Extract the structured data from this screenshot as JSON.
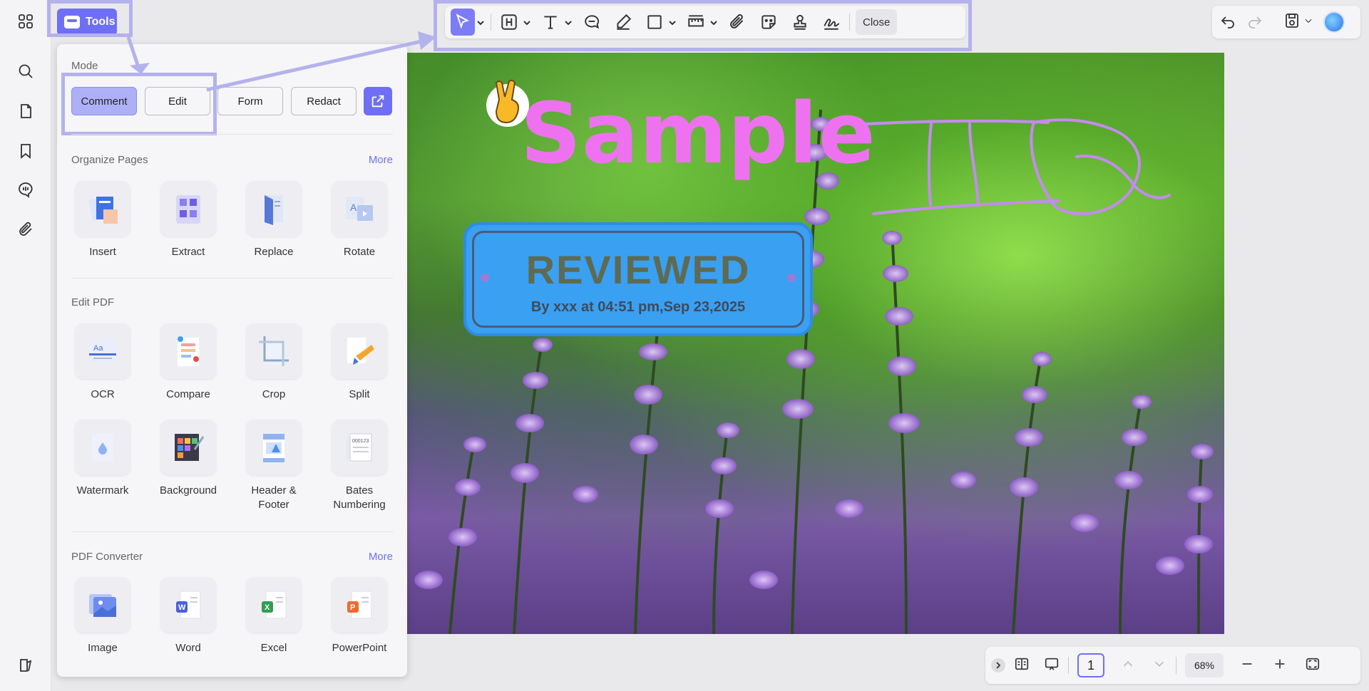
{
  "left_rail": {
    "items": [
      "apps-grid-icon",
      "search-icon",
      "pages-icon",
      "bookmark-icon",
      "comments-icon",
      "attachment-icon",
      "sidebar-settings-icon"
    ]
  },
  "tools_button": {
    "label": "Tools"
  },
  "toolbar": {
    "tools": [
      "select-pointer-icon",
      "highlight-text-icon",
      "text-box-icon",
      "comment-icon",
      "pencil-icon",
      "rectangle-shape-icon",
      "measure-icon",
      "attach-file-icon",
      "sticker-icon",
      "stamp-icon",
      "signature-icon"
    ],
    "close_label": "Close"
  },
  "panel": {
    "mode": {
      "label": "Mode",
      "buttons": [
        "Comment",
        "Edit",
        "Form",
        "Redact"
      ],
      "active": "Comment"
    },
    "organize": {
      "label": "Organize Pages",
      "more": "More",
      "tools": [
        "Insert",
        "Extract",
        "Replace",
        "Rotate"
      ]
    },
    "edit": {
      "label": "Edit PDF",
      "tools_row1": [
        "OCR",
        "Compare",
        "Crop",
        "Split"
      ],
      "tools_row2": [
        "Watermark",
        "Background",
        "Header & Footer",
        "Bates Numbering"
      ]
    },
    "converter": {
      "label": "PDF Converter",
      "more": "More",
      "tools": [
        "Image",
        "Word",
        "Excel",
        "PowerPoint"
      ]
    }
  },
  "document": {
    "sample_text": "Sample",
    "stamp_title": "REVIEWED",
    "stamp_sub": "By xxx at 04:51 pm,Sep 23,2025"
  },
  "bottom_bar": {
    "page_number": "1",
    "zoom": "68%"
  },
  "colors": {
    "accent": "#6f6ff5",
    "highlight_frame": "#b4b2ec",
    "sample_text": "#ee72f0",
    "stamp_fill": "#3aa0f2"
  }
}
